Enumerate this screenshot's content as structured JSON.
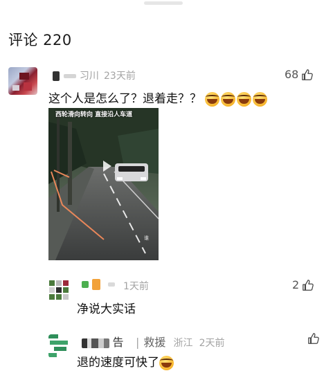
{
  "header": {
    "title": "评论 220"
  },
  "comments": [
    {
      "username_visible": "习川",
      "time": "23天前",
      "likes": "68",
      "text": "这个人是怎么了？退着走？？",
      "emoji_count": 4,
      "emoji": "laughing-crying-emoji",
      "video": {
        "caption": "西轮滑向转向 直接沿人车道"
      }
    },
    {
      "time": "1天前",
      "likes": "2",
      "text": "净说大实话"
    },
    {
      "username_visible": "告",
      "badge": "救援",
      "location": "浙江",
      "time": "2天前",
      "likes": "",
      "text": "退的速度可快了",
      "emoji": "laughing-crying-emoji"
    }
  ],
  "colors": {
    "meta_gray": "#a3a3a3",
    "text": "#111111",
    "divider": "#e6e6e6"
  }
}
